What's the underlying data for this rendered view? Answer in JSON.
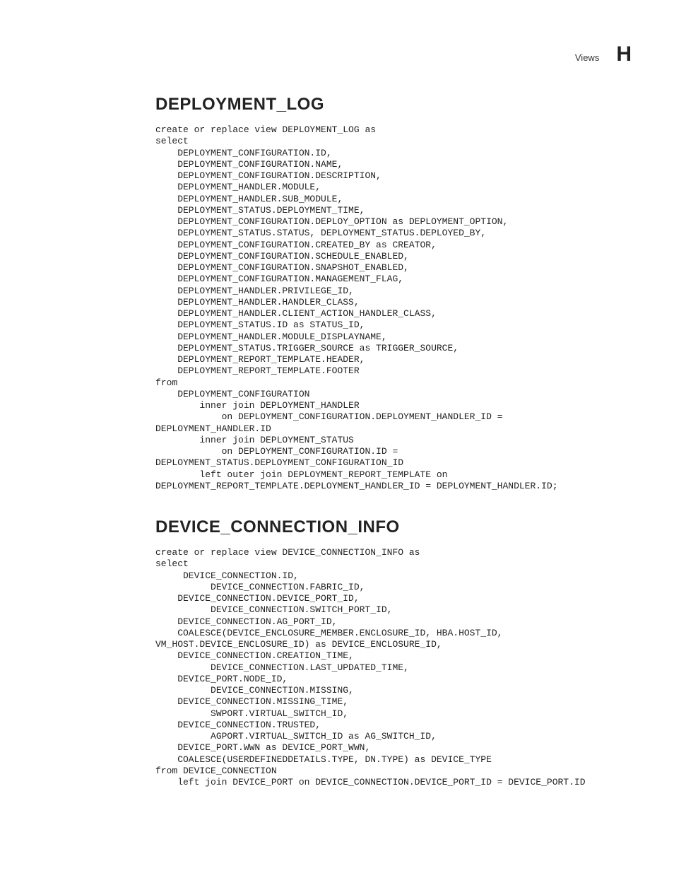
{
  "header": {
    "category": "Views",
    "appendix_letter": "H"
  },
  "sections": [
    {
      "heading": "DEPLOYMENT_LOG",
      "code": "create or replace view DEPLOYMENT_LOG as\nselect\n    DEPLOYMENT_CONFIGURATION.ID,\n    DEPLOYMENT_CONFIGURATION.NAME,\n    DEPLOYMENT_CONFIGURATION.DESCRIPTION,\n    DEPLOYMENT_HANDLER.MODULE,\n    DEPLOYMENT_HANDLER.SUB_MODULE,\n    DEPLOYMENT_STATUS.DEPLOYMENT_TIME,\n    DEPLOYMENT_CONFIGURATION.DEPLOY_OPTION as DEPLOYMENT_OPTION,\n    DEPLOYMENT_STATUS.STATUS, DEPLOYMENT_STATUS.DEPLOYED_BY,\n    DEPLOYMENT_CONFIGURATION.CREATED_BY as CREATOR,\n    DEPLOYMENT_CONFIGURATION.SCHEDULE_ENABLED,\n    DEPLOYMENT_CONFIGURATION.SNAPSHOT_ENABLED,\n    DEPLOYMENT_CONFIGURATION.MANAGEMENT_FLAG,\n    DEPLOYMENT_HANDLER.PRIVILEGE_ID,\n    DEPLOYMENT_HANDLER.HANDLER_CLASS,\n    DEPLOYMENT_HANDLER.CLIENT_ACTION_HANDLER_CLASS,\n    DEPLOYMENT_STATUS.ID as STATUS_ID,\n    DEPLOYMENT_HANDLER.MODULE_DISPLAYNAME,\n    DEPLOYMENT_STATUS.TRIGGER_SOURCE as TRIGGER_SOURCE,\n    DEPLOYMENT_REPORT_TEMPLATE.HEADER,\n    DEPLOYMENT_REPORT_TEMPLATE.FOOTER\nfrom\n    DEPLOYMENT_CONFIGURATION\n        inner join DEPLOYMENT_HANDLER\n            on DEPLOYMENT_CONFIGURATION.DEPLOYMENT_HANDLER_ID = \nDEPLOYMENT_HANDLER.ID\n        inner join DEPLOYMENT_STATUS\n            on DEPLOYMENT_CONFIGURATION.ID = \nDEPLOYMENT_STATUS.DEPLOYMENT_CONFIGURATION_ID\n        left outer join DEPLOYMENT_REPORT_TEMPLATE on \nDEPLOYMENT_REPORT_TEMPLATE.DEPLOYMENT_HANDLER_ID = DEPLOYMENT_HANDLER.ID;"
    },
    {
      "heading": "DEVICE_CONNECTION_INFO",
      "code": "create or replace view DEVICE_CONNECTION_INFO as\nselect\n     DEVICE_CONNECTION.ID,\n          DEVICE_CONNECTION.FABRIC_ID,\n    DEVICE_CONNECTION.DEVICE_PORT_ID,\n          DEVICE_CONNECTION.SWITCH_PORT_ID,\n    DEVICE_CONNECTION.AG_PORT_ID,\n    COALESCE(DEVICE_ENCLOSURE_MEMBER.ENCLOSURE_ID, HBA.HOST_ID, \nVM_HOST.DEVICE_ENCLOSURE_ID) as DEVICE_ENCLOSURE_ID,\n    DEVICE_CONNECTION.CREATION_TIME,\n          DEVICE_CONNECTION.LAST_UPDATED_TIME,\n    DEVICE_PORT.NODE_ID,\n          DEVICE_CONNECTION.MISSING,\n    DEVICE_CONNECTION.MISSING_TIME,\n          SWPORT.VIRTUAL_SWITCH_ID,\n    DEVICE_CONNECTION.TRUSTED,\n          AGPORT.VIRTUAL_SWITCH_ID as AG_SWITCH_ID,\n    DEVICE_PORT.WWN as DEVICE_PORT_WWN,\n    COALESCE(USERDEFINEDDETAILS.TYPE, DN.TYPE) as DEVICE_TYPE\nfrom DEVICE_CONNECTION\n    left join DEVICE_PORT on DEVICE_CONNECTION.DEVICE_PORT_ID = DEVICE_PORT.ID"
    }
  ]
}
